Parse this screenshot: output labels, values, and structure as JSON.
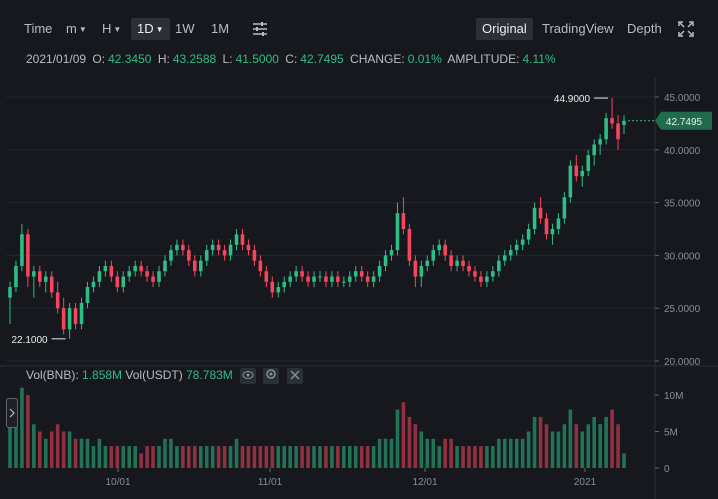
{
  "toolbar": {
    "time": "Time",
    "m": "m",
    "h": "H",
    "d1": "1D",
    "w1": "1W",
    "m1": "1M",
    "original": "Original",
    "tradingview": "TradingView",
    "depth": "Depth"
  },
  "ohlc": {
    "date": "2021/01/09",
    "o_label": "O:",
    "o": "42.3450",
    "h_label": "H:",
    "h": "43.2588",
    "l_label": "L:",
    "l": "41.5000",
    "c_label": "C:",
    "c": "42.7495",
    "change_label": "CHANGE:",
    "change": "0.01%",
    "amp_label": "AMPLITUDE:",
    "amp": "4.11%"
  },
  "volume_header": {
    "bnb_label": "Vol(BNB):",
    "bnb": "1.858M",
    "usdt_label": "Vol(USDT)",
    "usdt": "78.783M"
  },
  "colors": {
    "up": "#2ebd85",
    "down": "#f6465d",
    "bg": "#16181e",
    "grid": "#23262d",
    "text": "#848e9c"
  },
  "chart_data": {
    "type": "candlestick",
    "price_axis": {
      "ticks": [
        "45.0000",
        "40.0000",
        "35.0000",
        "30.0000",
        "25.0000",
        "20.0000"
      ],
      "min": 20,
      "max": 45
    },
    "volume_axis": {
      "ticks": [
        "10M",
        "5M",
        "0"
      ],
      "max": 10000000
    },
    "x_ticks": [
      "10/01",
      "11/01",
      "12/01",
      "2021"
    ],
    "current_price": "42.7495",
    "max_marker": "44.9000",
    "min_marker": "22.1000",
    "candles": [
      [
        26.0,
        27.5,
        23.5,
        27.0,
        8
      ],
      [
        27.0,
        29.5,
        26.5,
        29.0,
        7
      ],
      [
        29.0,
        33.0,
        28.5,
        32.0,
        11
      ],
      [
        32.0,
        32.5,
        27.0,
        28.0,
        10
      ],
      [
        28.0,
        29.0,
        26.0,
        28.5,
        6
      ],
      [
        28.5,
        29.0,
        27.0,
        27.5,
        5
      ],
      [
        27.5,
        28.5,
        26.5,
        28.0,
        4
      ],
      [
        28.0,
        28.5,
        26.0,
        26.5,
        5
      ],
      [
        26.5,
        27.5,
        24.5,
        25.0,
        6
      ],
      [
        25.0,
        26.0,
        22.5,
        23.0,
        5
      ],
      [
        23.0,
        25.5,
        22.1,
        25.0,
        5
      ],
      [
        25.0,
        25.5,
        23.0,
        23.5,
        4
      ],
      [
        23.5,
        26.0,
        23.0,
        25.5,
        4
      ],
      [
        25.5,
        27.5,
        25.0,
        27.0,
        4
      ],
      [
        27.0,
        28.0,
        26.5,
        27.5,
        3
      ],
      [
        27.5,
        29.0,
        27.0,
        28.5,
        4
      ],
      [
        28.5,
        29.5,
        28.0,
        29.0,
        3
      ],
      [
        29.0,
        29.5,
        27.5,
        28.0,
        3
      ],
      [
        28.0,
        28.5,
        26.5,
        27.0,
        3
      ],
      [
        27.0,
        28.5,
        26.5,
        28.0,
        3
      ],
      [
        28.0,
        29.0,
        27.5,
        28.5,
        3
      ],
      [
        28.5,
        29.5,
        28.0,
        29.0,
        3
      ],
      [
        29.0,
        29.5,
        28.0,
        28.5,
        2
      ],
      [
        28.5,
        29.0,
        27.5,
        28.0,
        3
      ],
      [
        28.0,
        28.5,
        27.0,
        27.5,
        3
      ],
      [
        27.5,
        29.0,
        27.0,
        28.5,
        3
      ],
      [
        28.5,
        30.0,
        28.0,
        29.5,
        4
      ],
      [
        29.5,
        31.0,
        29.0,
        30.5,
        4
      ],
      [
        30.5,
        31.5,
        30.0,
        31.0,
        3
      ],
      [
        31.0,
        31.5,
        30.0,
        30.5,
        3
      ],
      [
        30.5,
        31.0,
        29.0,
        29.5,
        3
      ],
      [
        29.5,
        30.0,
        28.0,
        28.5,
        3
      ],
      [
        28.5,
        30.0,
        28.0,
        29.5,
        3
      ],
      [
        29.5,
        31.0,
        29.0,
        30.5,
        3
      ],
      [
        30.5,
        31.5,
        30.0,
        31.0,
        3
      ],
      [
        31.0,
        31.5,
        30.0,
        30.5,
        3
      ],
      [
        30.5,
        31.0,
        29.5,
        30.0,
        3
      ],
      [
        30.0,
        31.5,
        29.5,
        31.0,
        3
      ],
      [
        31.0,
        32.5,
        30.5,
        32.0,
        4
      ],
      [
        32.0,
        32.5,
        30.5,
        31.0,
        3
      ],
      [
        31.0,
        31.5,
        30.0,
        30.5,
        3
      ],
      [
        30.5,
        31.0,
        29.0,
        29.5,
        3
      ],
      [
        29.5,
        30.0,
        28.0,
        28.5,
        3
      ],
      [
        28.5,
        29.0,
        27.0,
        27.5,
        3
      ],
      [
        27.5,
        28.0,
        26.0,
        26.5,
        3
      ],
      [
        26.5,
        27.5,
        26.0,
        27.0,
        3
      ],
      [
        27.0,
        28.0,
        26.5,
        27.5,
        3
      ],
      [
        27.5,
        28.5,
        27.0,
        28.0,
        3
      ],
      [
        28.0,
        29.0,
        27.5,
        28.5,
        3
      ],
      [
        28.5,
        29.0,
        27.5,
        28.0,
        3
      ],
      [
        28.0,
        28.5,
        27.0,
        27.5,
        3
      ],
      [
        27.5,
        28.5,
        27.0,
        28.0,
        3
      ],
      [
        28.0,
        28.5,
        27.5,
        28.0,
        3
      ],
      [
        28.0,
        28.5,
        27.0,
        27.5,
        3
      ],
      [
        27.5,
        28.5,
        27.0,
        28.0,
        3
      ],
      [
        28.0,
        28.5,
        27.0,
        27.5,
        3
      ],
      [
        27.5,
        28.0,
        27.0,
        27.5,
        3
      ],
      [
        27.5,
        28.5,
        27.0,
        28.0,
        3
      ],
      [
        28.0,
        29.0,
        27.5,
        28.5,
        3
      ],
      [
        28.5,
        29.0,
        27.5,
        28.0,
        3
      ],
      [
        28.0,
        28.5,
        27.0,
        27.5,
        3
      ],
      [
        27.5,
        28.5,
        27.0,
        28.0,
        3
      ],
      [
        28.0,
        29.5,
        27.5,
        29.0,
        4
      ],
      [
        29.0,
        30.5,
        28.5,
        30.0,
        4
      ],
      [
        30.0,
        31.0,
        29.5,
        30.5,
        4
      ],
      [
        30.5,
        35.0,
        30.0,
        34.0,
        8
      ],
      [
        34.0,
        35.5,
        32.0,
        32.5,
        9
      ],
      [
        32.5,
        33.0,
        29.0,
        29.5,
        7
      ],
      [
        29.5,
        30.0,
        27.0,
        28.0,
        6
      ],
      [
        28.0,
        29.5,
        27.0,
        29.0,
        5
      ],
      [
        29.0,
        30.0,
        28.5,
        29.5,
        4
      ],
      [
        29.5,
        31.0,
        29.0,
        30.5,
        4
      ],
      [
        30.5,
        31.5,
        30.0,
        31.0,
        3
      ],
      [
        31.0,
        31.5,
        29.5,
        30.0,
        4
      ],
      [
        30.0,
        30.5,
        28.5,
        29.0,
        4
      ],
      [
        29.0,
        30.0,
        28.5,
        29.5,
        3
      ],
      [
        29.5,
        30.0,
        28.5,
        29.0,
        3
      ],
      [
        29.0,
        29.5,
        28.0,
        28.5,
        3
      ],
      [
        28.5,
        29.0,
        27.5,
        28.0,
        3
      ],
      [
        28.0,
        28.5,
        27.0,
        27.5,
        3
      ],
      [
        27.5,
        28.5,
        27.0,
        28.0,
        3
      ],
      [
        28.0,
        29.0,
        27.5,
        28.5,
        3
      ],
      [
        28.5,
        30.0,
        28.0,
        29.5,
        4
      ],
      [
        29.5,
        30.5,
        29.0,
        30.0,
        4
      ],
      [
        30.0,
        31.0,
        29.5,
        30.5,
        4
      ],
      [
        30.5,
        31.5,
        30.0,
        31.0,
        4
      ],
      [
        31.0,
        32.0,
        30.5,
        31.5,
        4
      ],
      [
        31.5,
        33.0,
        31.0,
        32.5,
        5
      ],
      [
        32.5,
        35.0,
        32.0,
        34.5,
        7
      ],
      [
        34.5,
        35.5,
        33.0,
        33.5,
        7
      ],
      [
        33.5,
        34.0,
        31.5,
        32.0,
        6
      ],
      [
        32.0,
        33.0,
        31.0,
        32.5,
        5
      ],
      [
        32.5,
        34.0,
        32.0,
        33.5,
        5
      ],
      [
        33.5,
        36.0,
        33.0,
        35.5,
        6
      ],
      [
        35.5,
        39.0,
        35.0,
        38.5,
        8
      ],
      [
        38.5,
        39.5,
        37.0,
        37.5,
        6
      ],
      [
        37.5,
        38.5,
        36.5,
        38.0,
        5
      ],
      [
        38.0,
        40.0,
        37.5,
        39.5,
        6
      ],
      [
        39.5,
        41.0,
        38.5,
        40.5,
        7
      ],
      [
        40.5,
        41.5,
        39.5,
        41.0,
        6
      ],
      [
        41.0,
        43.5,
        40.5,
        43.0,
        7
      ],
      [
        43.0,
        44.9,
        42.0,
        42.5,
        8
      ],
      [
        42.5,
        43.3,
        40.0,
        41.0,
        6
      ],
      [
        42.35,
        43.26,
        41.5,
        42.75,
        2
      ]
    ]
  }
}
